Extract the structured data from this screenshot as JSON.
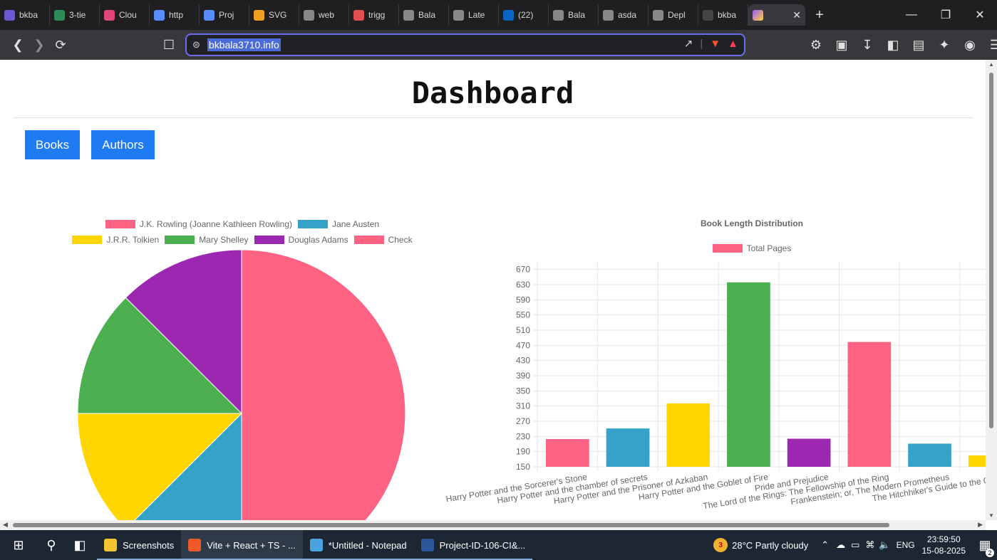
{
  "browser": {
    "tabs": [
      {
        "label": "bkba",
        "color": "#6a5acd"
      },
      {
        "label": "3-tie",
        "color": "#2e8b57"
      },
      {
        "label": "Clou",
        "color": "#e0457b"
      },
      {
        "label": "http",
        "color": "#5b8cff"
      },
      {
        "label": "Proj",
        "color": "#5b8cff"
      },
      {
        "label": "SVG",
        "color": "#f0a020"
      },
      {
        "label": "web",
        "color": "#888888"
      },
      {
        "label": "trigg",
        "color": "#e05050"
      },
      {
        "label": "Bala",
        "color": "#888888"
      },
      {
        "label": "Late",
        "color": "#888888"
      },
      {
        "label": "(22)",
        "color": "#0a66c2"
      },
      {
        "label": "Bala",
        "color": "#888888"
      },
      {
        "label": "asda",
        "color": "#888888"
      },
      {
        "label": "Depl",
        "color": "#888888"
      },
      {
        "label": "bkba",
        "color": "#444444"
      }
    ],
    "active_tab": {
      "label": "",
      "favicon": "vite-icon"
    },
    "url": "bkbala3710.info"
  },
  "page": {
    "title": "Dashboard",
    "nav": [
      {
        "label": "Books"
      },
      {
        "label": "Authors"
      }
    ]
  },
  "pie_legend": [
    {
      "label": "J.K. Rowling (Joanne Kathleen Rowling)",
      "color": "#ff6384"
    },
    {
      "label": "Jane Austen",
      "color": "#36a2c8"
    },
    {
      "label": "J.R.R. Tolkien",
      "color": "#ffd600"
    },
    {
      "label": "Mary Shelley",
      "color": "#4caf50"
    },
    {
      "label": "Douglas Adams",
      "color": "#9c27b0"
    },
    {
      "label": "Check",
      "color": "#ff6384"
    }
  ],
  "chart_data": [
    {
      "type": "pie",
      "title": "",
      "categories": [
        "J.K. Rowling (Joanne Kathleen Rowling)",
        "Jane Austen",
        "J.R.R. Tolkien",
        "Mary Shelley",
        "Douglas Adams",
        "Check"
      ],
      "values": [
        4,
        1,
        1,
        1,
        1,
        0
      ],
      "colors": [
        "#ff6384",
        "#36a2c8",
        "#ffd600",
        "#4caf50",
        "#9c27b0",
        "#ff6384"
      ],
      "legend": "top"
    },
    {
      "type": "bar",
      "title": "Book Length Distribution",
      "categories": [
        "Harry Potter and the Sorcerer's Stone",
        "Harry Potter and the chamber of secrets",
        "Harry Potter and the Prisoner of Azkaban",
        "Harry Potter and the Goblet of Fire",
        "Pride and Prejudice",
        "The Lord of the Rings: The Fellowship of the Ring",
        "Frankenstein; or, The Modern Prometheus",
        "The Hitchhiker's Guide to the Galaxy"
      ],
      "series": [
        {
          "name": "Total Pages",
          "values": [
            223,
            251,
            317,
            636,
            224,
            479,
            211,
            180
          ]
        }
      ],
      "colors": [
        "#ff6384",
        "#36a2c8",
        "#ffd600",
        "#4caf50",
        "#9c27b0",
        "#ff6384",
        "#36a2c8",
        "#ffd600"
      ],
      "ylim": [
        150,
        690
      ],
      "yticks": [
        150,
        190,
        230,
        270,
        310,
        350,
        390,
        430,
        470,
        510,
        550,
        590,
        630,
        670
      ],
      "grid": true,
      "legend": "top"
    }
  ],
  "taskbar": {
    "apps": [
      {
        "label": "Screenshots",
        "color": "#f4c430"
      },
      {
        "label": "Vite + React + TS - ...",
        "color": "#f05a28"
      },
      {
        "label": "*Untitled - Notepad",
        "color": "#4aa3df"
      },
      {
        "label": "Project-ID-106-CI&...",
        "color": "#2b579a"
      }
    ],
    "weather": "28°C  Partly cloudy",
    "weather_badge": "3",
    "language": "ENG",
    "time": "23:59:50",
    "date": "15-08-2025",
    "notification_count": "2"
  }
}
